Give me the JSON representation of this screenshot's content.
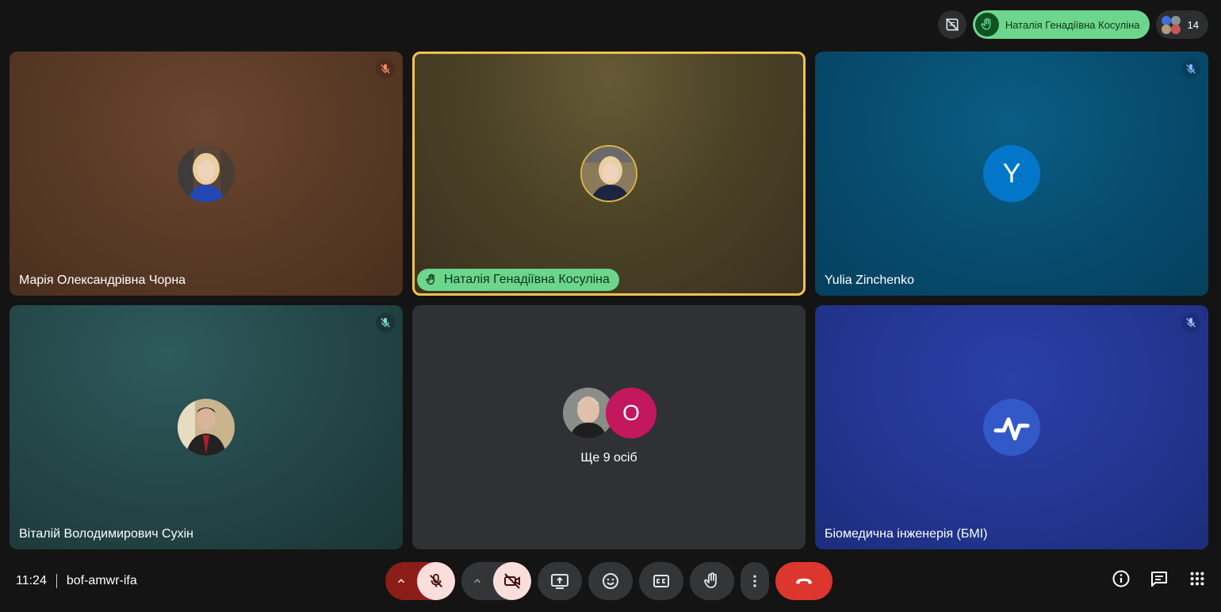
{
  "topbar": {
    "hand_raised_name": "Наталія Генадіївна Косуліна",
    "people_count": "14"
  },
  "tiles": [
    {
      "name": "Марія Олександрівна Чорна"
    },
    {
      "name": "Наталія Генадіївна Косуліна"
    },
    {
      "name": "Yulia Zinchenko",
      "initial": "Y"
    },
    {
      "name": "Віталій Володимирович Сухін"
    },
    {
      "more_label": "Ще 9 осіб",
      "initial": "О"
    },
    {
      "name": "Біомедична інженерія (БМІ)"
    }
  ],
  "bottombar": {
    "time": "11:24",
    "meeting_code": "bof-amwr-ifa"
  },
  "colors": {
    "raised_hand_green": "#6dd58c",
    "speaker_border": "#f3c24e",
    "hangup_red": "#dc362e",
    "muted_control_bg": "#f9dedc"
  }
}
